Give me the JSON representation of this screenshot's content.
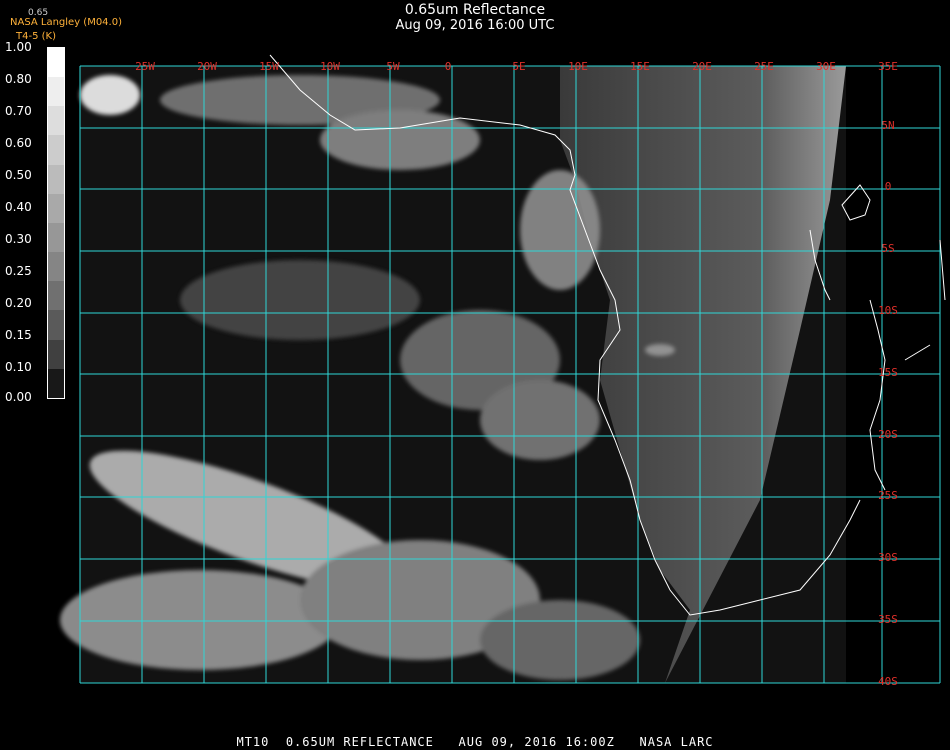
{
  "header": {
    "title": "0.65um Reflectance",
    "subtitle": "Aug 09, 2016 16:00 UTC"
  },
  "credit": {
    "top_value": "0.65",
    "agency": "NASA Langley (M04.0)",
    "product": "T4-5 (K)",
    "color": "#ffb23a"
  },
  "colorbar": {
    "labels": [
      "1.00",
      "0.80",
      "0.70",
      "0.60",
      "0.50",
      "0.40",
      "0.30",
      "0.25",
      "0.20",
      "0.15",
      "0.10",
      "0.00"
    ],
    "shades": [
      "#ffffff",
      "#eeeeee",
      "#dddddd",
      "#cccccc",
      "#bbbbbb",
      "#a9a9a9",
      "#979797",
      "#858585",
      "#707070",
      "#5a5a5a",
      "#404040",
      "#181818"
    ]
  },
  "map": {
    "grid_color": "#2fd6d6",
    "label_color": "#e0302a",
    "coast_color": "#ffffff",
    "lon_labels": [
      "25W",
      "20W",
      "15W",
      "10W",
      "5W",
      "0",
      "5E",
      "10E",
      "15E",
      "20E",
      "25E",
      "30E"
    ],
    "lat_labels": [
      "35E",
      "5N",
      "0",
      "5S",
      "10S",
      "15S",
      "20S",
      "25S",
      "30S",
      "35S",
      "40S"
    ]
  },
  "footer": {
    "text": "MT10  0.65UM REFLECTANCE   AUG 09, 2016 16:00Z   NASA LARC"
  }
}
